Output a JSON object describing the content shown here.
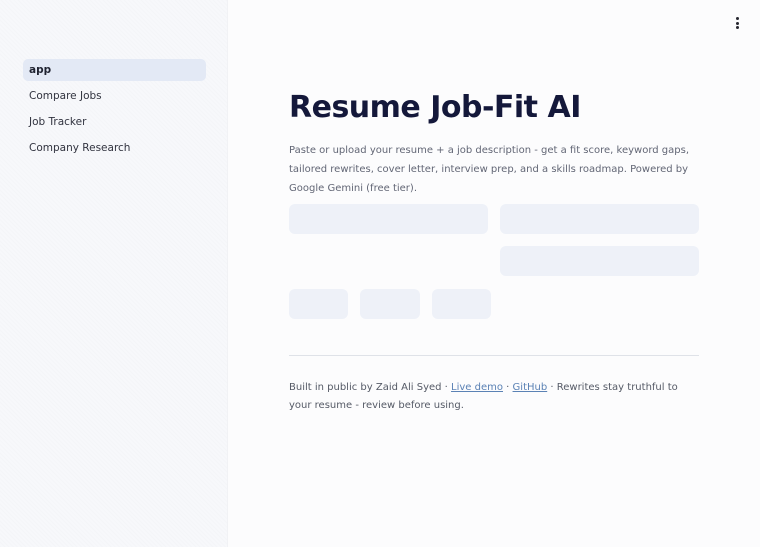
{
  "sidebar": {
    "items": [
      {
        "label": "app",
        "active": true
      },
      {
        "label": "Compare Jobs",
        "active": false
      },
      {
        "label": "Job Tracker",
        "active": false
      },
      {
        "label": "Company Research",
        "active": false
      }
    ]
  },
  "header": {
    "menu_icon": "vertical-dots-icon"
  },
  "main": {
    "title": "Resume Job-Fit AI",
    "description": "Paste or upload your resume + a job description - get a fit score, keyword gaps, tailored rewrites, cover letter, interview prep, and a skills roadmap. Powered by Google Gemini (free tier)."
  },
  "footer": {
    "prefix": "Built in public by Zaid Ali Syed · ",
    "live_demo": "Live demo",
    "separator": " · ",
    "github": "GitHub",
    "suffix": " · Rewrites stay truthful to your resume - review before using."
  },
  "colors": {
    "accent": "#14183a",
    "sidebar_active_bg": "#e3e9f5",
    "skeleton": "#eef1f8",
    "link": "#5b82b5"
  }
}
